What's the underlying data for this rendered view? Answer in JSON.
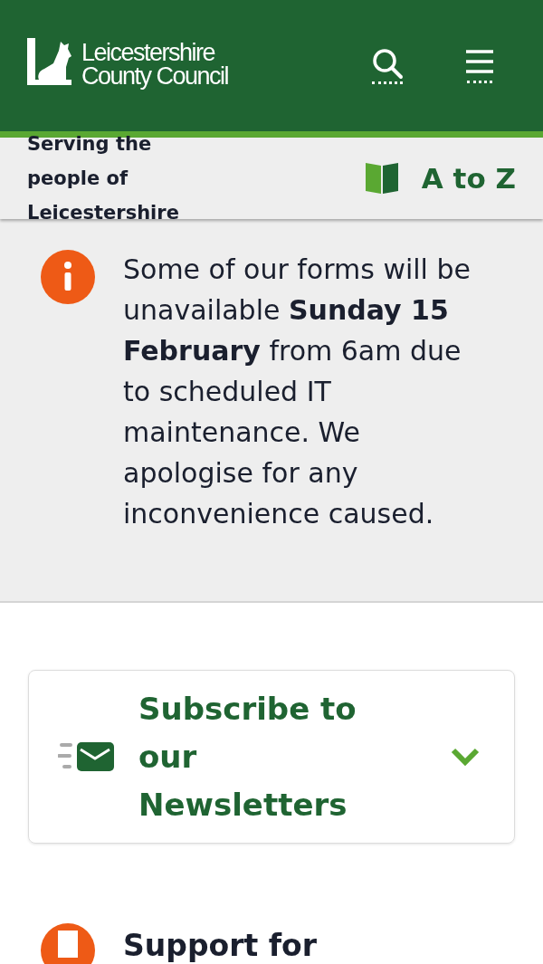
{
  "header": {
    "logo_line_1": "Leicestershire",
    "logo_line_2": "County Council"
  },
  "subheader": {
    "tagline": "Serving the people of Leicestershire",
    "a_to_z": "A to Z"
  },
  "alert": {
    "message": "Some of our forms will be\nunavailable **Sunday 15 February** from 6am due to scheduled IT maintenance. We apologise for any inconvenience caused."
  },
  "newsletter": {
    "title": "Subscribe to our Newsletters",
    "expanded": false
  },
  "next_section": {
    "title": "Support for"
  }
}
